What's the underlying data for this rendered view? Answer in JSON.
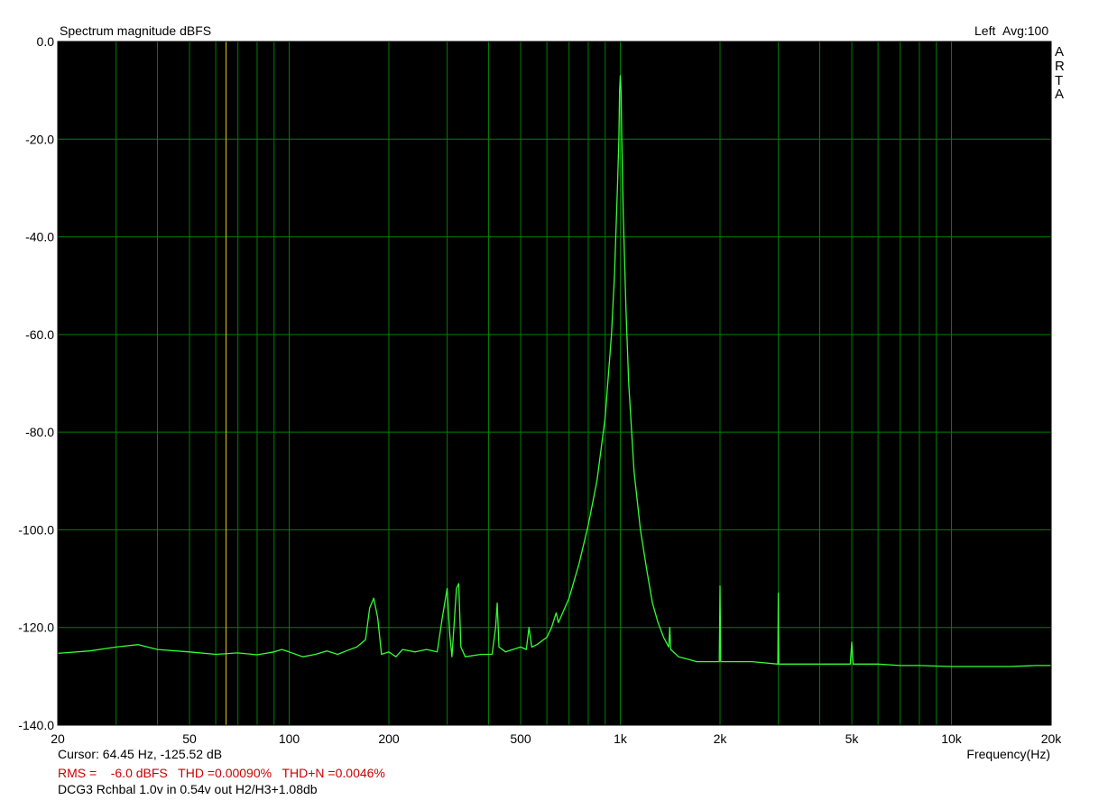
{
  "chart_data": {
    "type": "line",
    "title": "Spectrum magnitude dBFS",
    "channel_label": "Left",
    "avg_label": "Avg:100",
    "brand_letters": [
      "A",
      "R",
      "T",
      "A"
    ],
    "xlabel": "Frequency(Hz)",
    "ylabel": "",
    "x_scale": "log",
    "xlim": [
      20,
      20000
    ],
    "ylim": [
      -140,
      0
    ],
    "x_ticks": [
      {
        "value": 20,
        "label": "20"
      },
      {
        "value": 50,
        "label": "50"
      },
      {
        "value": 100,
        "label": "100"
      },
      {
        "value": 200,
        "label": "200"
      },
      {
        "value": 500,
        "label": "500"
      },
      {
        "value": 1000,
        "label": "1k"
      },
      {
        "value": 2000,
        "label": "2k"
      },
      {
        "value": 5000,
        "label": "5k"
      },
      {
        "value": 10000,
        "label": "10k"
      },
      {
        "value": 20000,
        "label": "20k"
      }
    ],
    "y_ticks": [
      {
        "value": 0,
        "label": "0.0"
      },
      {
        "value": -20,
        "label": "-20.0"
      },
      {
        "value": -40,
        "label": "-40.0"
      },
      {
        "value": -60,
        "label": "-60.0"
      },
      {
        "value": -80,
        "label": "-80.0"
      },
      {
        "value": -100,
        "label": "-100.0"
      },
      {
        "value": -120,
        "label": "-120.0"
      },
      {
        "value": -140,
        "label": "-140.0"
      }
    ],
    "grid": true,
    "cursor_frequency": 64.45,
    "series": [
      {
        "color": "#33ff33",
        "x": [
          20,
          25,
          30,
          35,
          40,
          50,
          60,
          70,
          80,
          90,
          95,
          100,
          110,
          120,
          130,
          140,
          150,
          160,
          170,
          175,
          180,
          185,
          190,
          200,
          210,
          220,
          240,
          260,
          280,
          290,
          300,
          305,
          310,
          320,
          325,
          330,
          340,
          380,
          410,
          420,
          425,
          430,
          450,
          500,
          520,
          530,
          540,
          560,
          600,
          620,
          640,
          650,
          700,
          750,
          800,
          850,
          900,
          940,
          960,
          980,
          990,
          995,
          1000,
          1005,
          1010,
          1020,
          1040,
          1060,
          1100,
          1150,
          1200,
          1250,
          1300,
          1350,
          1400,
          1410,
          1420,
          1500,
          1600,
          1700,
          1800,
          1900,
          1990,
          2000,
          2010,
          2100,
          2500,
          2990,
          3000,
          3010,
          3500,
          4000,
          4950,
          5000,
          5050,
          6000,
          7000,
          8000,
          10000,
          12000,
          15000,
          18000,
          20000
        ],
        "y": [
          -125.3,
          -124.8,
          -124.0,
          -123.5,
          -124.5,
          -125.0,
          -125.5,
          -125.2,
          -125.6,
          -125.0,
          -124.5,
          -125.0,
          -126.0,
          -125.5,
          -124.8,
          -125.5,
          -124.7,
          -124.0,
          -122.5,
          -116.0,
          -114.0,
          -118.0,
          -125.5,
          -125.0,
          -126.0,
          -124.5,
          -125.0,
          -124.5,
          -125.0,
          -118.0,
          -112.0,
          -121.0,
          -126.0,
          -112.0,
          -111.0,
          -124.0,
          -126.0,
          -125.5,
          -125.5,
          -120.0,
          -115.0,
          -124.0,
          -125.0,
          -124.0,
          -124.5,
          -120.0,
          -124.0,
          -123.5,
          -122.0,
          -120.0,
          -117.0,
          -119.0,
          -114.0,
          -107.0,
          -99.0,
          -90.0,
          -77.0,
          -60.0,
          -48.0,
          -30.0,
          -20.0,
          -10.0,
          -7.0,
          -10.0,
          -20.0,
          -35.0,
          -55.0,
          -70.0,
          -88.0,
          -100.0,
          -108.0,
          -115.0,
          -119.0,
          -122.0,
          -124.0,
          -120.0,
          -124.5,
          -126.0,
          -126.5,
          -127.0,
          -127.0,
          -127.0,
          -127.0,
          -111.5,
          -127.0,
          -127.0,
          -127.0,
          -127.5,
          -113.0,
          -127.5,
          -127.5,
          -127.5,
          -127.5,
          -123.0,
          -127.5,
          -127.5,
          -127.8,
          -127.8,
          -128.0,
          -128.0,
          -128.0,
          -127.8,
          -127.8
        ]
      }
    ],
    "cursor_label": "Cursor: 64.45 Hz, -125.52 dB",
    "stats_label": "RMS =    -6.0 dBFS   THD =0.00090%   THD+N =0.0046%",
    "note_label": "DCG3 Rchbal 1.0v in 0.54v out H2/H3+1.08db",
    "colors": {
      "plot_background": "#000000",
      "grid": "#008000",
      "cursor": "#e6c800",
      "stats_text": "#cc0000"
    }
  }
}
